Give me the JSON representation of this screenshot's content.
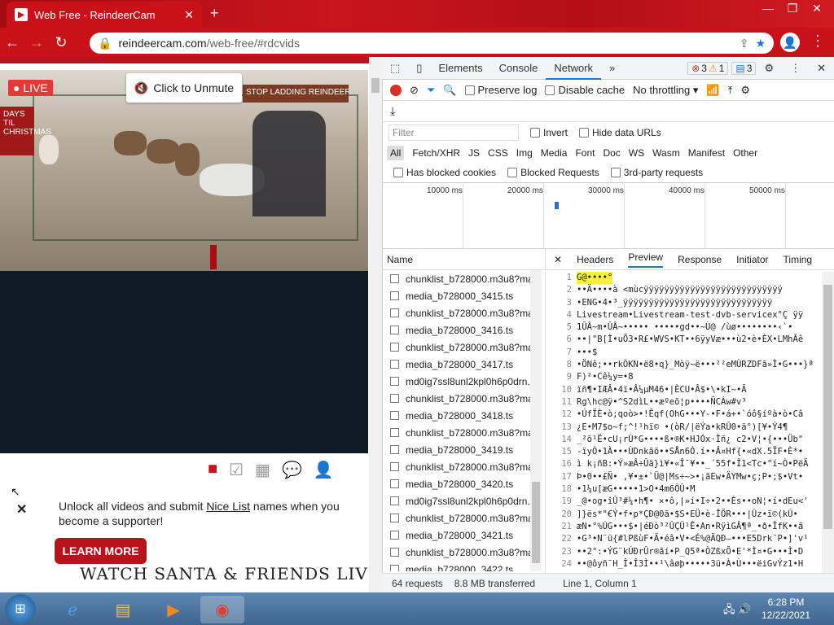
{
  "browser": {
    "tab_title": "Web Free - ReindeerCam",
    "tab_close": "✕",
    "new_tab": "+",
    "url_host": "reindeercam.com",
    "url_path": "/web-free/#rdcvids",
    "win_min": "—",
    "win_max": "❐",
    "win_close": "✕",
    "accent": "#c81119"
  },
  "page": {
    "live": "LIVE",
    "unmute": "Click to Unmute",
    "promo_text1": "Unlock all videos and submit ",
    "promo_link": "Nice List",
    "promo_text2": " names when you become a supporter!",
    "learn_more": "LEARN MORE",
    "watch": "WATCH SANTA & FRIENDS LIVE!",
    "close": "✕",
    "sign_text": "STOP LADDING REINDEER BACK",
    "days_text": "DAYS TIL CHRISTMAS"
  },
  "devtools": {
    "tabs": [
      "Elements",
      "Console",
      "Network"
    ],
    "selected_tab": "Network",
    "more": "»",
    "errors": "3",
    "warnings": "1",
    "messages": "3",
    "preserve_log": "Preserve log",
    "disable_cache": "Disable cache",
    "throttling": "No throttling",
    "filter_placeholder": "Filter",
    "invert": "Invert",
    "hide_data_urls": "Hide data URLs",
    "types": [
      "All",
      "Fetch/XHR",
      "JS",
      "CSS",
      "Img",
      "Media",
      "Font",
      "Doc",
      "WS",
      "Wasm",
      "Manifest",
      "Other"
    ],
    "has_blocked_cookies": "Has blocked cookies",
    "blocked_requests": "Blocked Requests",
    "third_party": "3rd-party requests",
    "timeline_ticks": [
      "10000 ms",
      "20000 ms",
      "30000 ms",
      "40000 ms",
      "50000 ms"
    ],
    "name_header": "Name",
    "requests": [
      "chunklist_b728000.m3u8?max",
      "media_b728000_3415.ts",
      "chunklist_b728000.m3u8?max",
      "media_b728000_3416.ts",
      "chunklist_b728000.m3u8?max",
      "media_b728000_3417.ts",
      "md0ig7ssl8unl2kpl0h6p0drn.l",
      "chunklist_b728000.m3u8?max",
      "media_b728000_3418.ts",
      "chunklist_b728000.m3u8?max",
      "media_b728000_3419.ts",
      "chunklist_b728000.m3u8?max",
      "media_b728000_3420.ts",
      "md0ig7ssl8unl2kpl0h6p0drn.l",
      "chunklist_b728000.m3u8?max",
      "media_b728000_3421.ts",
      "chunklist_b728000.m3u8?max",
      "media_b728000_3422.ts"
    ],
    "preview_close": "✕",
    "preview_tabs": [
      "Headers",
      "Preview",
      "Response",
      "Initiator",
      "Timing"
    ],
    "selected_preview_tab": "Preview",
    "code_lines": [
      "G@••••°",
      "••Ä••••à <mùcÿÿÿÿÿÿÿÿÿÿÿÿÿÿÿÿÿÿÿÿÿÿÿÿÿÿÿ",
      "•ENG•4•³_ÿÿÿÿÿÿÿÿÿÿÿÿÿÿÿÿÿÿÿÿÿÿÿÿÿÿÿÿÿ",
      "Livestream•Livestream-test-dvb-servicex°Ç ÿÿ",
      "1ÛÂ~m•ÛÂ~•••••  •••••gd••~Ù@ /ùø••••••••‹`•",
      "••|\"B[Ì•uÕ3•R£•WVS•KT••6ÿyVæ•••ù2•è•ÈX•LMhÂê",
      "•••$",
      "•ÖNê;••rkÒKN•ë8•q}_Mòÿ~ë•••²²eMÙRZDFã»Ì•G•••}ª",
      "F)²•Cê¼y=•8",
      "ïñ¶•IÆÂ•4ï•Â¼µM46•|ÈCU•Â$•\\•kI~•Ä",
      "Rg\\hc@ÿ•^S2dìL••æºeõ¦p••••ÑCÁw#v³",
      "•ÚfÏÈ•ò;qoò>•!Êqf(OhG•••Y-•F•á+•`óô§íºà•ò•Câ",
      "¿E•M7$o~f;^!¹hï©    •(òR/|ëÝa•kRÛ0•ä°)[¥•Ý4¶",
      "_²õ¹Ë•cU¡rÙ*G••••ß•®K•HJÓx·Ìñ¿ c2•V¦•{•••Üb\"",
      "-ïyÒ•1À•••ÙDnkãõ••SÅn6Ó.í••Â¤Hf{•«dX.5ÏF•È*•",
      "ì k¡ñB:•Ý»æÂ÷Ûä}ì¥•«Î¯¥••_´55f•Î1<Tc•°í~Ò•PëÄ",
      "Þ•0••£Ñ• ,¥•±•`Ü@|Ms÷~>•¡ãEw•ÄYMw•ç;P•;$•Vt•",
      "•1¼u[æG•••••1>O•4m6ÔÛ•M",
      "_@•og•îÛ³#¼•h¶• ×•ô,|»í•I÷•2••Ès••oN¦•í•dEu<'",
      "]}ës*\"€Ý•f•p*ÇÐ@0ã•$S•EÜ•è-ÎÕR•••|Ûz•ï©(kÚ•",
      "æN•°%ÚG•••$•|éÐò³²ÛÇÛ¹Ê•An•RÿìGÂ¶ª_•ð•ÎfK••ã",
      "•G³•N¨ü{#lPßùF•Ä•éâ•V•<É%@ÄQÐ–•••E5Drk¨P•]'v¹",
      "••2°:•ÝG¨kÚÐrÛr®ãí•P_Q5ª•ÒZßxÕ•E'*Ì¤•G•••Ì•D",
      "••@ôyñ¯H_Î•Î3Ì••¹\\âøþ•••••3ü•À•Ù•••ëiGvÝz1•H"
    ],
    "status_requests": "64 requests",
    "status_transferred": "8.8 MB transferred",
    "status_cursor": "Line 1, Column 1"
  },
  "taskbar": {
    "time": "6:28 PM",
    "date": "12/22/2021"
  }
}
